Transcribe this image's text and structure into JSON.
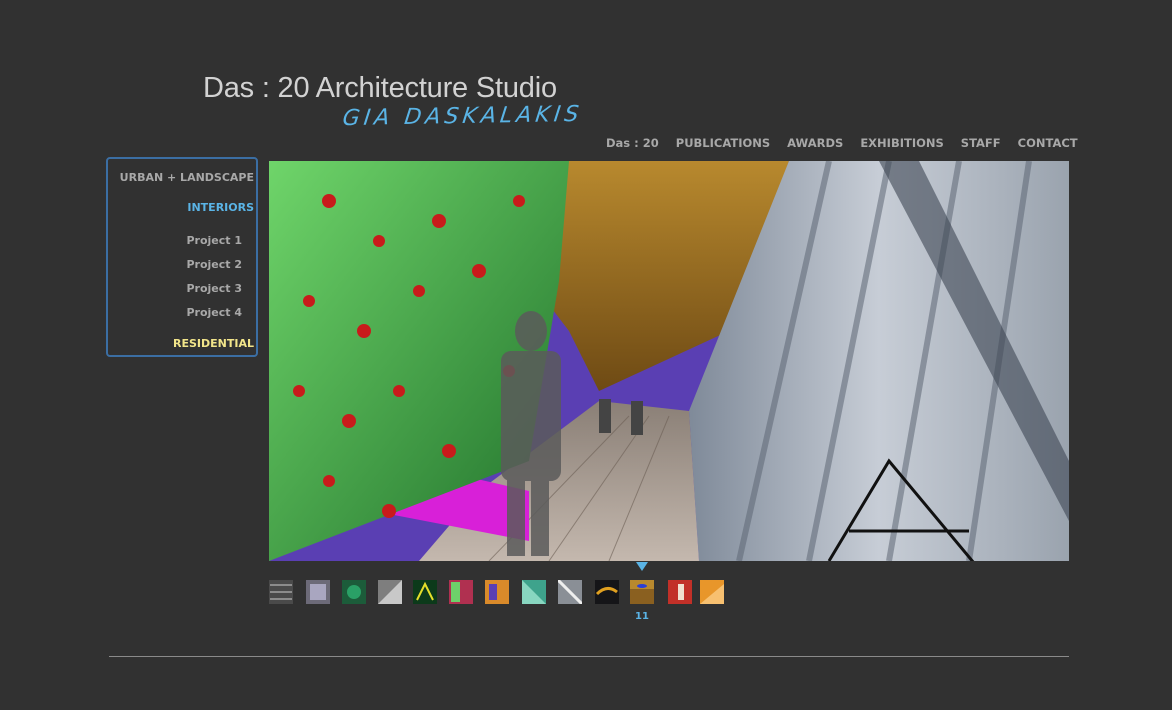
{
  "header": {
    "title": "Das : 20 Architecture Studio",
    "signature": "GIA DASKALAKIS"
  },
  "nav": {
    "items": [
      "Das : 20",
      "PUBLICATIONS",
      "AWARDS",
      "EXHIBITIONS",
      "STAFF",
      "CONTACT"
    ]
  },
  "sidebar": {
    "urban": "URBAN + LANDSCAPE",
    "interiors": "INTERIORS",
    "projects": [
      "Project 1",
      "Project 2",
      "Project 3",
      "Project 4"
    ],
    "residential": "RESIDENTIAL"
  },
  "gallery": {
    "selected_number": "11",
    "thumb_count": 13,
    "selected_index": 11
  },
  "colors": {
    "background": "#313131",
    "accent_blue": "#5ab4e6",
    "accent_yellow": "#f2e58a",
    "menu_border": "#3b6ea3",
    "text_gray": "#a8a8a8"
  }
}
